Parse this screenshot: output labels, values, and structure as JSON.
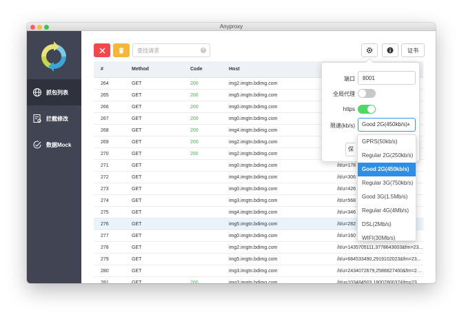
{
  "window": {
    "title": "Anyproxy"
  },
  "sidebar": {
    "items": [
      {
        "label": "抓包列表",
        "icon": "globe-icon",
        "active": true
      },
      {
        "label": "拦截修改",
        "icon": "intercept-icon",
        "active": false
      },
      {
        "label": "数据Mock",
        "icon": "mock-check-icon",
        "active": false
      }
    ]
  },
  "toolbar": {
    "clear_icon": "close-icon",
    "stop_icon": "trash-icon",
    "search_placeholder": "查找请求",
    "settings_icon": "gear-icon",
    "info_icon": "info-icon",
    "cert_label": "证书"
  },
  "table": {
    "headers": {
      "id": "#",
      "method": "Method",
      "code": "Code",
      "host": "Host"
    },
    "rows": [
      {
        "id": "264",
        "method": "GET",
        "code": "200",
        "host": "img2.imgtn.bdimg.com",
        "path": ""
      },
      {
        "id": "265",
        "method": "GET",
        "code": "200",
        "host": "img5.imgtn.bdimg.com",
        "path": ""
      },
      {
        "id": "266",
        "method": "GET",
        "code": "200",
        "host": "img0.imgtn.bdimg.com",
        "path": ""
      },
      {
        "id": "267",
        "method": "GET",
        "code": "200",
        "host": "img0.imgtn.bdimg.com",
        "path": ""
      },
      {
        "id": "268",
        "method": "GET",
        "code": "200",
        "host": "img4.imgtn.bdimg.com",
        "path": ""
      },
      {
        "id": "269",
        "method": "GET",
        "code": "200",
        "host": "img2.imgtn.bdimg.com",
        "path": ""
      },
      {
        "id": "270",
        "method": "GET",
        "code": "200",
        "host": "img2.imgtn.bdimg.com",
        "path": ""
      },
      {
        "id": "271",
        "method": "GET",
        "code": "",
        "host": "img0.imgtn.bdimg.com",
        "path": "/it/u=178"
      },
      {
        "id": "272",
        "method": "GET",
        "code": "",
        "host": "img4.imgtn.bdimg.com",
        "path": "/it/u=306"
      },
      {
        "id": "273",
        "method": "GET",
        "code": "",
        "host": "img0.imgtn.bdimg.com",
        "path": "/it/u=426"
      },
      {
        "id": "274",
        "method": "GET",
        "code": "",
        "host": "img3.imgtn.bdimg.com",
        "path": "/it/u=568"
      },
      {
        "id": "275",
        "method": "GET",
        "code": "",
        "host": "img4.imgtn.bdimg.com",
        "path": "/it/u=346"
      },
      {
        "id": "276",
        "method": "GET",
        "code": "",
        "host": "img5.imgtn.bdimg.com",
        "path": "/it/u=282"
      },
      {
        "id": "277",
        "method": "GET",
        "code": "",
        "host": "img0.imgtn.bdimg.com",
        "path": "/it/u=160"
      },
      {
        "id": "278",
        "method": "GET",
        "code": "",
        "host": "img2.imgtn.bdimg.com",
        "path": "/it/u=1435705111,3778643003&fm=23..."
      },
      {
        "id": "279",
        "method": "GET",
        "code": "",
        "host": "img5.imgtn.bdimg.com",
        "path": "/it/u=684533490,2919102023&fm=23..."
      },
      {
        "id": "280",
        "method": "GET",
        "code": "",
        "host": "img3.imgtn.bdimg.com",
        "path": "/it/u=2434072679,2588827400&fm=23..."
      },
      {
        "id": "281",
        "method": "GET",
        "code": "200",
        "host": "img3.imgtn.bdimg.com",
        "path": "/it/u=103484503,1800780037&fm=23..."
      }
    ]
  },
  "settings_popover": {
    "port_label": "端口",
    "port_value": "8001",
    "global_proxy_label": "全局代理",
    "global_proxy_on": false,
    "https_label": "https",
    "https_on": true,
    "throttle_label": "限速(kb/s)",
    "throttle_value": "Good 2G(450kb/s)",
    "save_label": "保"
  },
  "throttle_dropdown": {
    "options": [
      "GPRS(50kb/s)",
      "Regular 2G(250kb/s)",
      "Good 2G(450kb/s)",
      "Regular 3G(750kb/s)",
      "Good 3G(1.5Mb/s)",
      "Regular 4G(4Mb/s)",
      "DSL(2Mb/s)",
      "WIFI(30Mb/s)"
    ],
    "selected_index": 2
  },
  "colors": {
    "sidebar_bg": "#414553",
    "sidebar_active": "#2f323d",
    "clear_red": "#f5474b",
    "stop_orange": "#f5b63a",
    "status_green": "#4cae4f",
    "toggle_on": "#4cd964",
    "selected_blue": "#2d8ee8"
  }
}
